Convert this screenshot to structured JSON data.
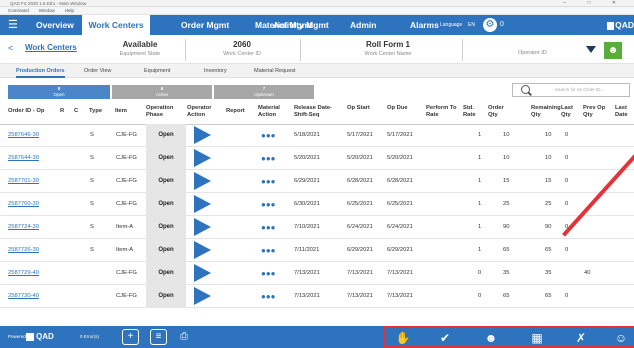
{
  "window": {
    "title": "QAD FS 2020 1.5 EE1 - Main Window",
    "controls": "– □ ✕"
  },
  "menubar": {
    "items": [
      "Command",
      "Window",
      "Help"
    ]
  },
  "topnav": {
    "items": [
      "Overview",
      "Work Centers",
      "Order Mgmt",
      "Material Mgmt",
      "Activity Mgmt",
      "Admin",
      "Alarms"
    ],
    "active": "Work Centers",
    "language_label": "Language",
    "language_value": "EN",
    "gear_badge": "0",
    "brand": "QAD"
  },
  "header": {
    "back": "<",
    "work_centers_link": "Work Centers",
    "state_value": "Available",
    "state_label": "Equipment State",
    "wc_id_value": "2060",
    "wc_id_label": "Work Center ID",
    "wc_name_value": "Roll Form 1",
    "wc_name_label": "Work Center Name",
    "operator_label": "Operator ID"
  },
  "subtabs": [
    "Production Orders",
    "Order View",
    "Equipment",
    "Inventory",
    "Material Request"
  ],
  "filters": [
    {
      "count": "8",
      "label": "Open",
      "color": "#4a86c8"
    },
    {
      "count": "6",
      "label": "Active",
      "color": "#a7a7a7"
    },
    {
      "count": "7",
      "label": "Upstream",
      "color": "#a7a7a7"
    }
  ],
  "search": {
    "placeholder": "Search for an Order ID..."
  },
  "table": {
    "columns": [
      "Order ID - Op",
      "R",
      "C",
      "Type",
      "Item",
      "Operation Phase",
      "Operator Action",
      "Report",
      "Material Action",
      "Release Date-Shift-Seq",
      "Op Start",
      "Op Due",
      "Perform To Rate",
      "Std. Rate",
      "Order Qty",
      "Remaining Qty",
      "Last Qty",
      "Prev Op Qty",
      "Last Date"
    ],
    "rows": [
      {
        "order": "2587646-30",
        "type": "S",
        "item": "CJE-FG",
        "phase": "Open",
        "release": "5/18/2021",
        "start": "5/17/2021",
        "due": "5/17/2021",
        "rate": "1",
        "qty": "10",
        "remaining": "10",
        "last": "0",
        "prev": ""
      },
      {
        "order": "2587644-30",
        "type": "S",
        "item": "CJE-FG",
        "phase": "Open",
        "release": "5/20/2021",
        "start": "5/20/2021",
        "due": "5/20/2021",
        "rate": "1",
        "qty": "10",
        "remaining": "10",
        "last": "0",
        "prev": ""
      },
      {
        "order": "2587701-30",
        "type": "S",
        "item": "CJE-FG",
        "phase": "Open",
        "release": "6/29/2021",
        "start": "6/28/2021",
        "due": "6/28/2021",
        "rate": "1",
        "qty": "15",
        "remaining": "15",
        "last": "0",
        "prev": ""
      },
      {
        "order": "2587700-30",
        "type": "S",
        "item": "CJE-FG",
        "phase": "Open",
        "release": "6/30/2021",
        "start": "6/25/2021",
        "due": "6/25/2021",
        "rate": "1",
        "qty": "25",
        "remaining": "25",
        "last": "0",
        "prev": ""
      },
      {
        "order": "2587724-30",
        "type": "S",
        "item": "Item-A",
        "phase": "Open",
        "release": "7/10/2021",
        "start": "6/24/2021",
        "due": "6/24/2021",
        "rate": "1",
        "qty": "90",
        "remaining": "90",
        "last": "0",
        "prev": ""
      },
      {
        "order": "2587726-30",
        "type": "S",
        "item": "Item-A",
        "phase": "Open",
        "release": "7/11/2021",
        "start": "6/29/2021",
        "due": "6/29/2021",
        "rate": "1",
        "qty": "65",
        "remaining": "65",
        "last": "0",
        "prev": ""
      },
      {
        "order": "2587729-40",
        "type": "",
        "item": "CJE-FG",
        "phase": "Open",
        "release": "7/13/2021",
        "start": "7/13/2021",
        "due": "7/13/2021",
        "rate": "0",
        "qty": "35",
        "remaining": "35",
        "last": "",
        "prev": "40"
      },
      {
        "order": "2587730-40",
        "type": "",
        "item": "CJE-FG",
        "phase": "Open",
        "release": "7/13/2021",
        "start": "7/13/2021",
        "due": "7/13/2021",
        "rate": "0",
        "qty": "65",
        "remaining": "65",
        "last": "0",
        "prev": ""
      }
    ]
  },
  "footer": {
    "powered_by": "Powered By",
    "brand": "QAD",
    "errors": "0 Error(s)"
  },
  "icons": [
    "menu-icon",
    "gear-icon",
    "add-icon",
    "list-icon",
    "printer-icon",
    "scanner-icon",
    "check-icon",
    "user-icon",
    "grid-icon",
    "wrench-icon",
    "person-icon"
  ],
  "colors": {
    "primary": "#2d73bd",
    "operator_green": "#59ad3a",
    "highlight_red": "#e53238"
  }
}
